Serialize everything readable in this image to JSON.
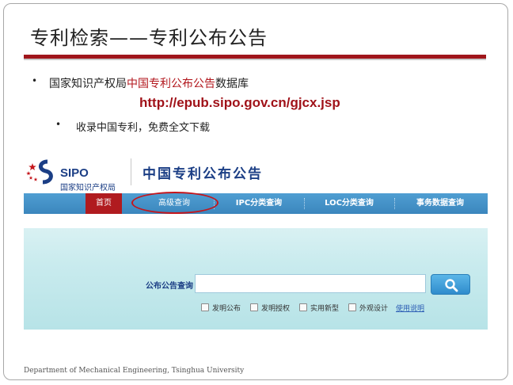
{
  "slide": {
    "title": "专利检索——专利公布公告",
    "bullet1": {
      "marker": "•",
      "prefix": "国家知识产权局",
      "highlight": "中国专利公布公告",
      "suffix": "数据库"
    },
    "url": "http://epub.sipo.gov.cn/gjcx.jsp",
    "bullet2": {
      "marker": "•",
      "text": "收录中国专利，免费全文下载"
    },
    "footer": "Department of Mechanical Engineering, Tsinghua University"
  },
  "screenshot": {
    "logo": {
      "text": "SIPO",
      "subtitle": "国家知识产权局"
    },
    "site_title": "中国专利公布公告",
    "nav": [
      "首页",
      "高级查询",
      "IPC分类查询",
      "LOC分类查询",
      "事务数据查询"
    ],
    "search": {
      "label": "公布公告查询",
      "input_value": "",
      "options": [
        "发明公布",
        "发明授权",
        "实用新型",
        "外观设计"
      ],
      "help_link": "使用说明"
    }
  },
  "colors": {
    "accent_red": "#a0161b",
    "nav_blue": "#3b86bd",
    "brand_blue": "#1b3e85"
  }
}
